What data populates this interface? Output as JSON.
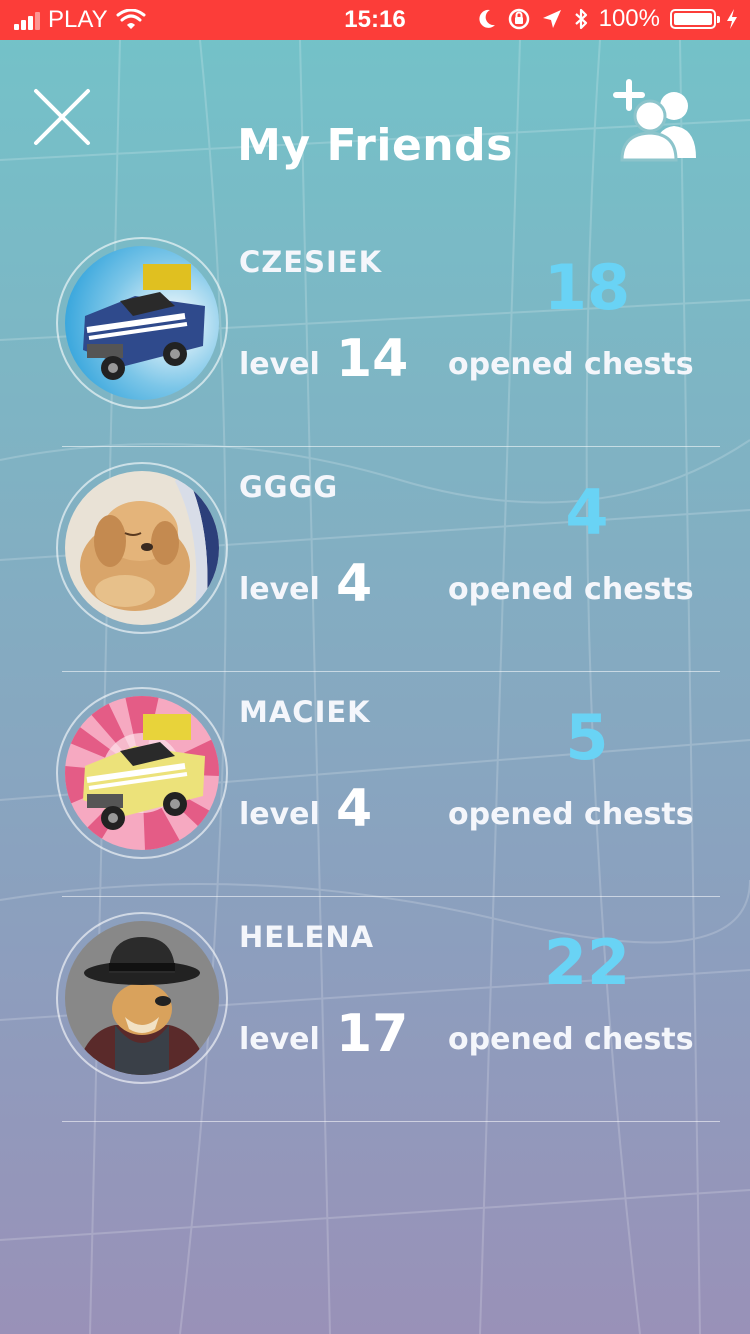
{
  "status_bar": {
    "carrier": "PLAY",
    "time": "15:16",
    "battery": "100%"
  },
  "header": {
    "title": "My Friends"
  },
  "friends": [
    {
      "name": "CZESIEK",
      "level_label": "level",
      "level": "14",
      "chests": "18",
      "chests_label": "opened chests",
      "avatar": "blue-car-avatar"
    },
    {
      "name": "GGGG",
      "level_label": "level",
      "level": "4",
      "chests": "4",
      "chests_label": "opened chests",
      "avatar": "puppy-avatar"
    },
    {
      "name": "MACIEK",
      "level_label": "level",
      "level": "4",
      "chests": "5",
      "chests_label": "opened chests",
      "avatar": "yellow-car-avatar"
    },
    {
      "name": "HELENA",
      "level_label": "level",
      "level": "17",
      "chests": "22",
      "chests_label": "opened chests",
      "avatar": "dog-in-hat-avatar"
    }
  ],
  "colors": {
    "status_bar": "#fc3d39",
    "chests_accent": "#69d3f5",
    "background_top": "#73c3c9",
    "background_bottom": "#9991b8"
  },
  "icons": {
    "close": "close-icon",
    "add_friend": "add-friend-icon"
  }
}
